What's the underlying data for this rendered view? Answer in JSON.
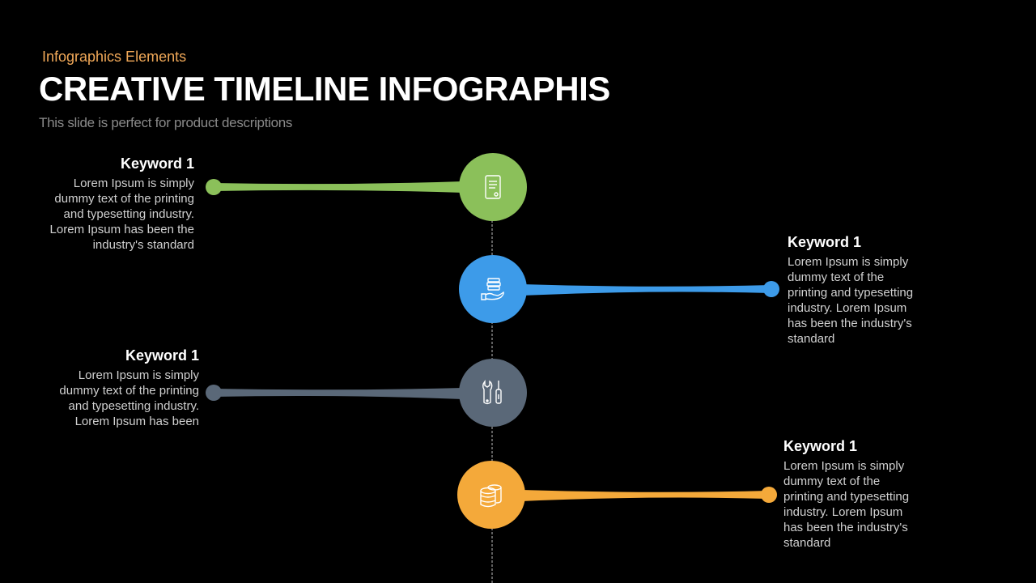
{
  "header": {
    "kicker": "Infographics  Elements",
    "title": "CREATIVE TIMELINE INFOGRAPHIS",
    "subtitle": "This slide is perfect for product descriptions"
  },
  "colors": {
    "background": "#000000",
    "green": "#8bc05a",
    "blue": "#3d9be9",
    "slate": "#5a6878",
    "orange": "#f4a93a",
    "kicker": "#f0a858"
  },
  "timeline": [
    {
      "side": "left",
      "color": "#8bc05a",
      "icon": "document-icon",
      "keyword": "Keyword 1",
      "text": "Lorem Ipsum  is simply dummy  text  of the printing and typesetting industry.  Lorem Ipsum has been the  industry's standard"
    },
    {
      "side": "right",
      "color": "#3d9be9",
      "icon": "hand-stack-icon",
      "keyword": "Keyword 1",
      "text": "Lorem Ipsum  is simply dummy  text  of the printing and typesetting industry.  Lorem Ipsum has been the  industry's standard"
    },
    {
      "side": "left",
      "color": "#5a6878",
      "icon": "tools-icon",
      "keyword": "Keyword 1",
      "text": "Lorem Ipsum  is simply dummy  text  of the printing and typesetting industry.  Lorem Ipsum has been"
    },
    {
      "side": "right",
      "color": "#f4a93a",
      "icon": "database-icon",
      "keyword": "Keyword 1",
      "text": "Lorem Ipsum  is simply dummy  text  of the printing and typesetting industry.  Lorem Ipsum has been the  industry's standard"
    }
  ]
}
